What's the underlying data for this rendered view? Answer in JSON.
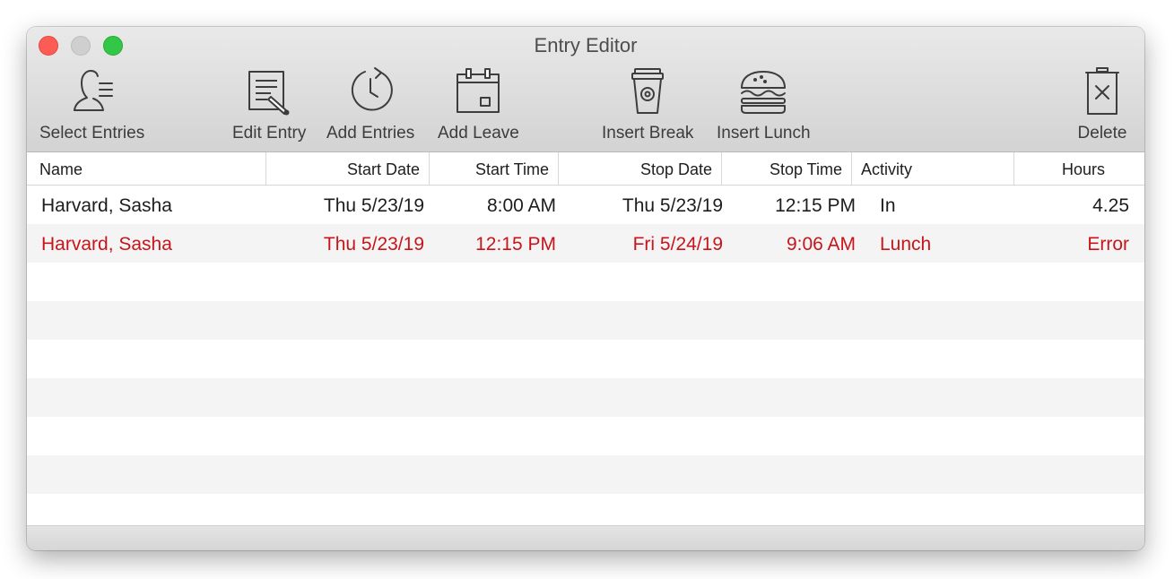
{
  "window": {
    "title": "Entry Editor"
  },
  "toolbar": {
    "select_entries": "Select Entries",
    "edit_entry": "Edit Entry",
    "add_entries": "Add Entries",
    "add_leave": "Add Leave",
    "insert_break": "Insert Break",
    "insert_lunch": "Insert Lunch",
    "delete": "Delete"
  },
  "table": {
    "columns": {
      "name": "Name",
      "start_date": "Start Date",
      "start_time": "Start Time",
      "stop_date": "Stop Date",
      "stop_time": "Stop Time",
      "activity": "Activity",
      "hours": "Hours"
    },
    "rows": [
      {
        "name": "Harvard, Sasha",
        "start_date": "Thu 5/23/19",
        "start_time": "8:00 AM",
        "stop_date": "Thu 5/23/19",
        "stop_time": "12:15 PM",
        "activity": "In",
        "hours": "4.25",
        "status": "normal"
      },
      {
        "name": "Harvard, Sasha",
        "start_date": "Thu 5/23/19",
        "start_time": "12:15 PM",
        "stop_date": "Fri 5/24/19",
        "stop_time": "9:06 AM",
        "activity": "Lunch",
        "hours": "Error",
        "status": "error"
      }
    ]
  },
  "colors": {
    "error_text": "#c7151b",
    "close": "#fd5c55",
    "zoom": "#33c748"
  }
}
